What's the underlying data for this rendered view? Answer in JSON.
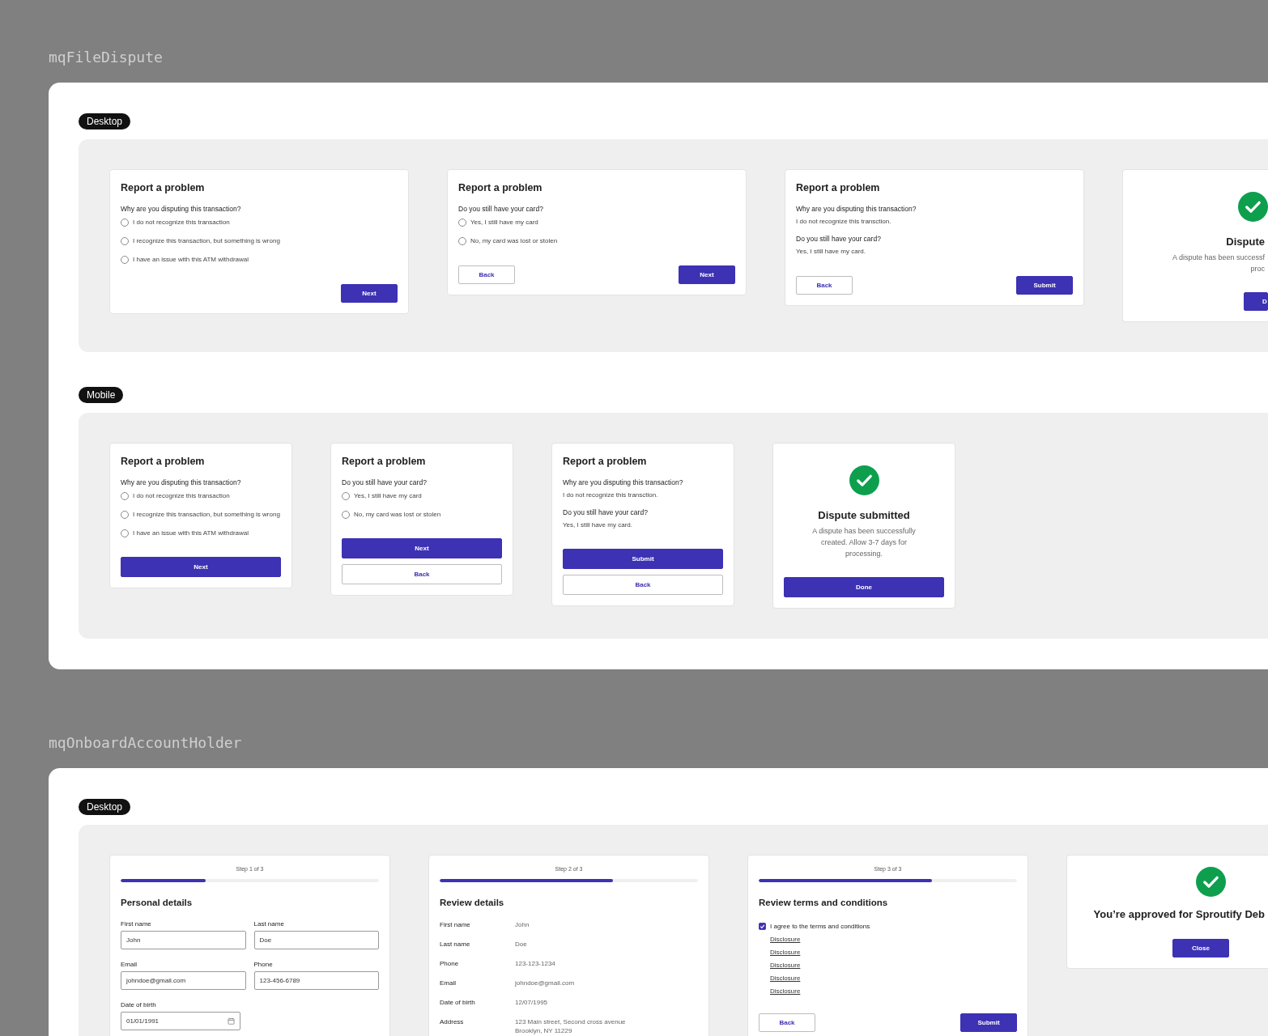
{
  "sections": [
    {
      "title": "mqFileDispute",
      "groups": [
        {
          "label": "Desktop",
          "kind": "desktop",
          "cards": [
            {
              "kind": "question",
              "title": "Report a problem",
              "question": "Why are you disputing this transaction?",
              "options": [
                {
                  "label": "I do not recognize this transaction",
                  "selected": false
                },
                {
                  "label": "I recognize this transaction, but something is wrong",
                  "selected": false
                },
                {
                  "label": "I have an issue with this ATM withdrawal",
                  "selected": false
                }
              ],
              "buttons": [
                {
                  "label": "Next",
                  "kind": "primary"
                }
              ]
            },
            {
              "kind": "question",
              "title": "Report a problem",
              "question": "Do you still have your card?",
              "options": [
                {
                  "label": "Yes, I still have my card",
                  "selected": false
                },
                {
                  "label": "No, my card was lost or stolen",
                  "selected": false
                }
              ],
              "buttons": [
                {
                  "label": "Back",
                  "kind": "secondary"
                },
                {
                  "label": "Next",
                  "kind": "primary"
                }
              ]
            },
            {
              "kind": "summary",
              "title": "Report a problem",
              "items": [
                {
                  "question": "Why are you disputing this transaction?",
                  "answer": "I do not recognize this transction."
                },
                {
                  "question": "Do you still have your card?",
                  "answer": "Yes, I still have my card."
                }
              ],
              "buttons": [
                {
                  "label": "Back",
                  "kind": "secondary"
                },
                {
                  "label": "Submit",
                  "kind": "primary"
                }
              ]
            },
            {
              "kind": "success",
              "title": "Dispute",
              "lines": [
                "A dispute has been successf",
                "proc"
              ],
              "buttons": [
                {
                  "label": "D",
                  "kind": "primary"
                }
              ]
            }
          ]
        },
        {
          "label": "Mobile",
          "kind": "mobile",
          "cards": [
            {
              "kind": "question",
              "title": "Report a problem",
              "question": "Why are you disputing this transaction?",
              "options": [
                {
                  "label": "I do not recognize this transaction",
                  "selected": false
                },
                {
                  "label": "I recognize this transaction, but something is wrong",
                  "selected": false
                },
                {
                  "label": "I have an issue with this ATM withdrawal",
                  "selected": false
                }
              ],
              "buttons": [
                {
                  "label": "Next",
                  "kind": "primary"
                }
              ]
            },
            {
              "kind": "question",
              "title": "Report a problem",
              "question": "Do you still have your card?",
              "options": [
                {
                  "label": "Yes, I still have my card",
                  "selected": false
                },
                {
                  "label": "No, my card was lost or stolen",
                  "selected": false
                }
              ],
              "buttons": [
                {
                  "label": "Next",
                  "kind": "primary"
                },
                {
                  "label": "Back",
                  "kind": "secondary"
                }
              ]
            },
            {
              "kind": "summary",
              "title": "Report a problem",
              "items": [
                {
                  "question": "Why are you disputing this transaction?",
                  "answer": "I do not recognize this transction."
                },
                {
                  "question": "Do you still have your card?",
                  "answer": "Yes, I still have my card."
                }
              ],
              "buttons": [
                {
                  "label": "Submit",
                  "kind": "primary"
                },
                {
                  "label": "Back",
                  "kind": "secondary"
                }
              ]
            },
            {
              "kind": "success",
              "title": "Dispute submitted",
              "lines": [
                "A dispute has been successfully",
                "created. Allow 3-7 days for",
                "processing."
              ],
              "buttons": [
                {
                  "label": "Done",
                  "kind": "primary"
                }
              ]
            }
          ]
        }
      ]
    },
    {
      "title": "mqOnboardAccountHolder",
      "groups": [
        {
          "label": "Desktop",
          "kind": "desktop",
          "cards": [
            {
              "kind": "form",
              "step": "Step 1 of 3",
              "level": 0.33,
              "heading": "Personal details",
              "fields": [
                {
                  "label": "First name",
                  "value": "John",
                  "kind": "text"
                },
                {
                  "label": "Last name",
                  "value": "Doe",
                  "kind": "text"
                },
                {
                  "label": "Email",
                  "value": "johndoe@gmail.com",
                  "kind": "text"
                },
                {
                  "label": "Phone",
                  "value": "123-456-6789",
                  "kind": "text"
                },
                {
                  "label": "Date of birth",
                  "value": "01/01/1991",
                  "kind": "date"
                }
              ]
            },
            {
              "kind": "review",
              "step": "Step 2 of 3",
              "level": 0.67,
              "heading": "Review details",
              "rows": [
                {
                  "label": "First name",
                  "lines": [
                    "John"
                  ]
                },
                {
                  "label": "Last name",
                  "lines": [
                    "Doe"
                  ]
                },
                {
                  "label": "Phone",
                  "lines": [
                    "123-123-1234"
                  ]
                },
                {
                  "label": "Email",
                  "lines": [
                    "johndoe@gmail.com"
                  ]
                },
                {
                  "label": "Date of birth",
                  "lines": [
                    "12/07/1995"
                  ]
                },
                {
                  "label": "Address",
                  "lines": [
                    "123 Main street, Second cross avenue",
                    "Brooklyn, NY 11229"
                  ]
                }
              ]
            },
            {
              "kind": "terms",
              "step": "Step 3 of 3",
              "level": 0.67,
              "heading": "Review terms and conditions",
              "agree": {
                "label": "I agree to the terms and conditions",
                "checked": true
              },
              "links": [
                "Disclosure",
                "Disclosure",
                "Disclosure",
                "Disclosure",
                "Disclosure"
              ],
              "buttons": [
                {
                  "label": "Back",
                  "kind": "secondary"
                },
                {
                  "label": "Submit",
                  "kind": "primary"
                }
              ]
            },
            {
              "kind": "approved",
              "title": "You’re approved for Sproutify Deb",
              "buttons": [
                {
                  "label": "Close",
                  "kind": "primary"
                }
              ]
            }
          ]
        }
      ]
    }
  ]
}
